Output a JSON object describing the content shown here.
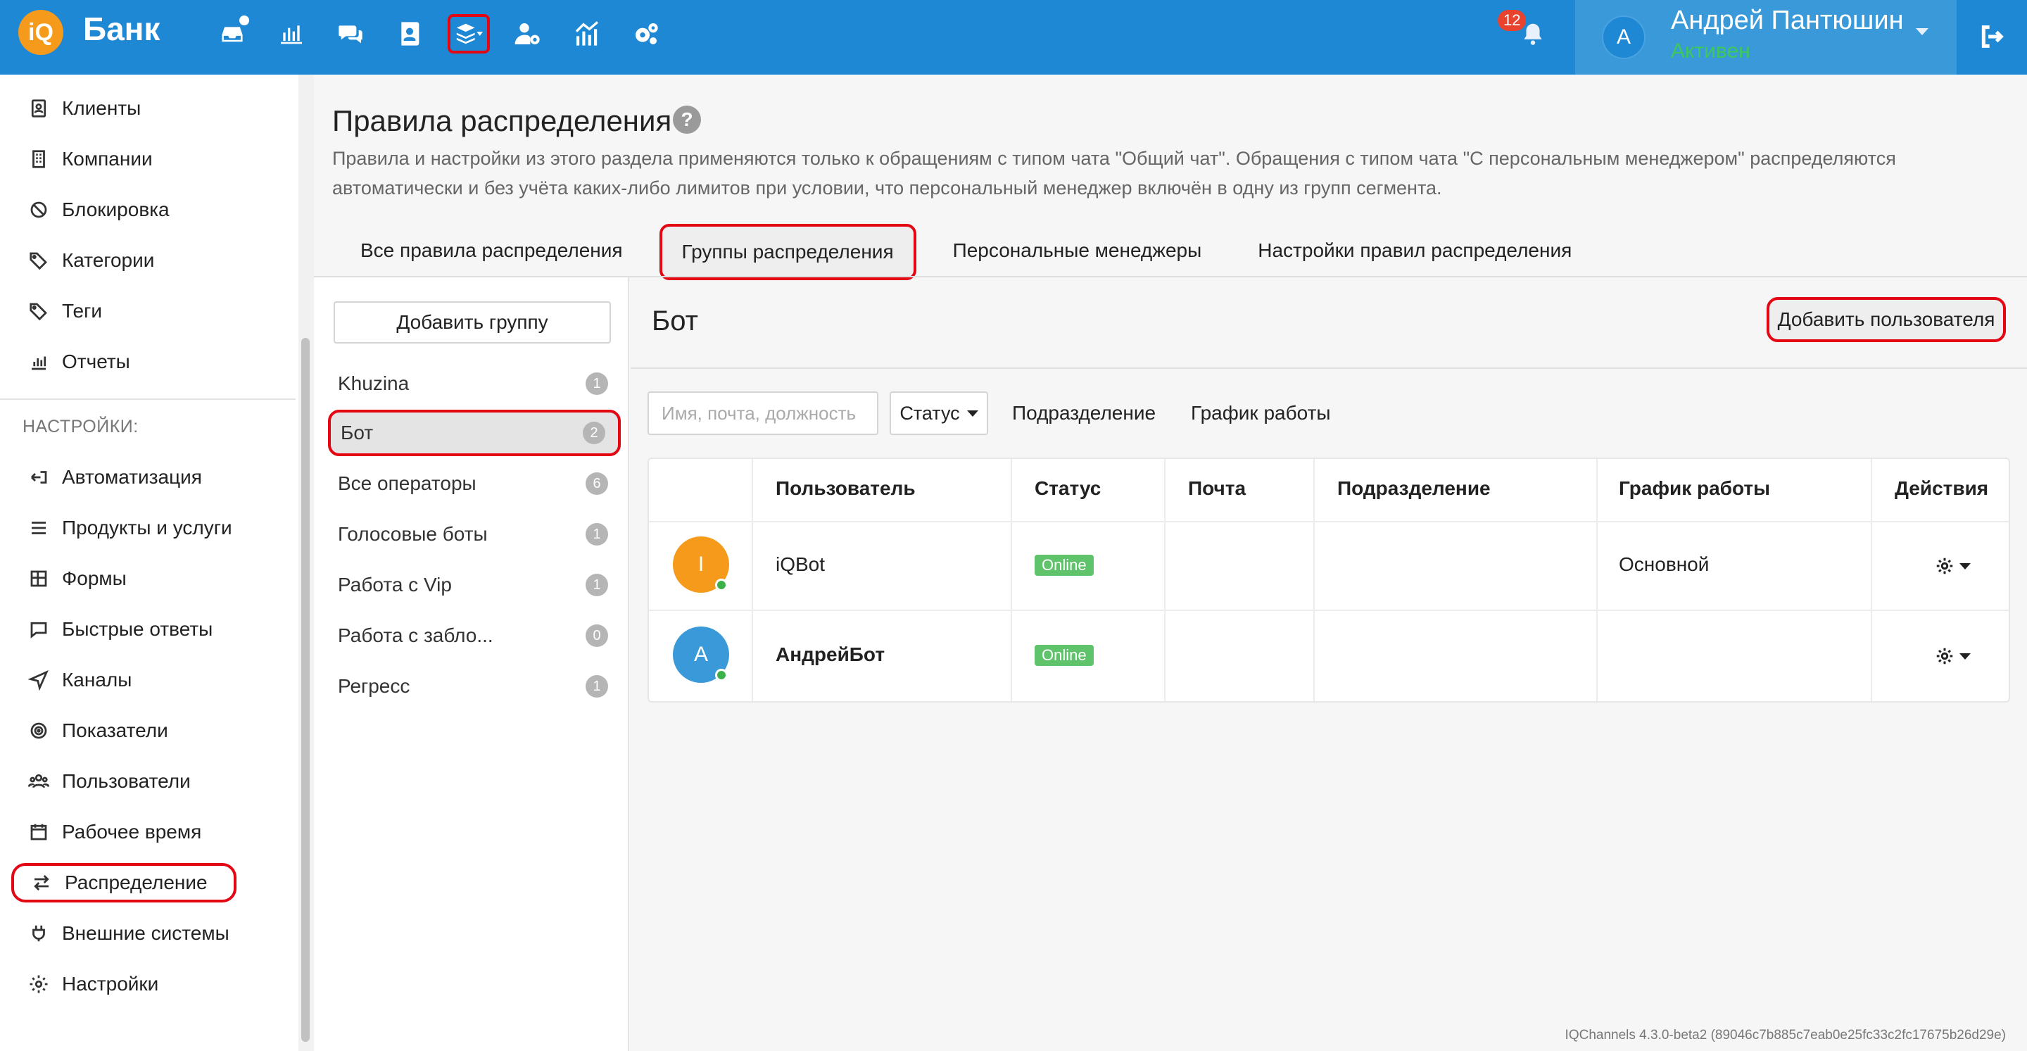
{
  "topbar": {
    "logo_text": "iQ",
    "brand": "Банк",
    "icons": [
      "inbox-icon",
      "bar-chart-icon",
      "chat-icon",
      "contact-card-icon",
      "layers-icon",
      "user-settings-icon",
      "analytics-icon",
      "cogs-icon"
    ],
    "notifications_count": "12",
    "user": {
      "avatar_letter": "А",
      "name": "Андрей Пантюшин",
      "status": "Активен"
    }
  },
  "sidebar": {
    "items": [
      {
        "label": "Клиенты",
        "icon": "contact-icon"
      },
      {
        "label": "Компании",
        "icon": "building-icon"
      },
      {
        "label": "Блокировка",
        "icon": "ban-icon"
      },
      {
        "label": "Категории",
        "icon": "tags-icon"
      },
      {
        "label": "Теги",
        "icon": "tag-icon"
      },
      {
        "label": "Отчеты",
        "icon": "chart-icon"
      }
    ],
    "settings_heading": "НАСТРОЙКИ:",
    "settings_items": [
      {
        "label": "Автоматизация",
        "icon": "automation-icon"
      },
      {
        "label": "Продукты и услуги",
        "icon": "list-icon"
      },
      {
        "label": "Формы",
        "icon": "form-icon"
      },
      {
        "label": "Быстрые ответы",
        "icon": "quick-reply-icon"
      },
      {
        "label": "Каналы",
        "icon": "send-icon"
      },
      {
        "label": "Показатели",
        "icon": "target-icon"
      },
      {
        "label": "Пользователи",
        "icon": "users-icon"
      },
      {
        "label": "Рабочее время",
        "icon": "calendar-icon"
      },
      {
        "label": "Распределение",
        "icon": "swap-icon"
      },
      {
        "label": "Внешние системы",
        "icon": "plug-icon"
      },
      {
        "label": "Настройки",
        "icon": "gear-icon"
      }
    ]
  },
  "page": {
    "title": "Правила распределения",
    "description": "Правила и настройки из этого раздела применяются только к обращениям с типом чата \"Общий чат\". Обращения с типом чата \"С персональным менеджером\" распределяются автоматически и без учёта каких-либо лимитов при условии, что персональный менеджер включён в одну из групп сегмента.",
    "tabs": [
      "Все правила распределения",
      "Группы распределения",
      "Персональные менеджеры",
      "Настройки правил распределения"
    ],
    "active_tab": "Группы распределения"
  },
  "groups": {
    "add_button": "Добавить группу",
    "items": [
      {
        "name": "Khuzina",
        "count": "1"
      },
      {
        "name": "Бот",
        "count": "2"
      },
      {
        "name": "Все операторы",
        "count": "6"
      },
      {
        "name": "Голосовые боты",
        "count": "1"
      },
      {
        "name": "Работа с Vip",
        "count": "1"
      },
      {
        "name": "Работа с забло...",
        "count": "0"
      },
      {
        "name": "Регресс",
        "count": "1"
      }
    ]
  },
  "detail": {
    "title": "Бот",
    "add_user_button": "Добавить пользователя",
    "filters": {
      "search_placeholder": "Имя, почта, должность",
      "status_label": "Статус",
      "department_label": "Подразделение",
      "schedule_label": "График работы"
    },
    "table": {
      "headers": [
        "Пользователь",
        "Статус",
        "Почта",
        "Подразделение",
        "График работы",
        "Действия"
      ],
      "rows": [
        {
          "avatar_letter": "I",
          "avatar_color": "#f59a1b",
          "name": "iQBot",
          "status": "Online",
          "email": "",
          "department": "",
          "schedule": "Основной"
        },
        {
          "avatar_letter": "А",
          "avatar_color": "#3a9ad9",
          "name": "АндрейБот",
          "status": "Online",
          "email": "",
          "department": "",
          "schedule": ""
        }
      ]
    }
  },
  "footer": {
    "version": "IQChannels 4.3.0-beta2 (89046c7b885c7eab0e25fc33c2fc17675b26d29e)"
  },
  "colors": {
    "topbar": "#1e88d4",
    "user_panel": "#3a9ad9",
    "status_active": "#3cc95a",
    "highlight": "#e30613",
    "online_badge": "#5ec36b"
  }
}
